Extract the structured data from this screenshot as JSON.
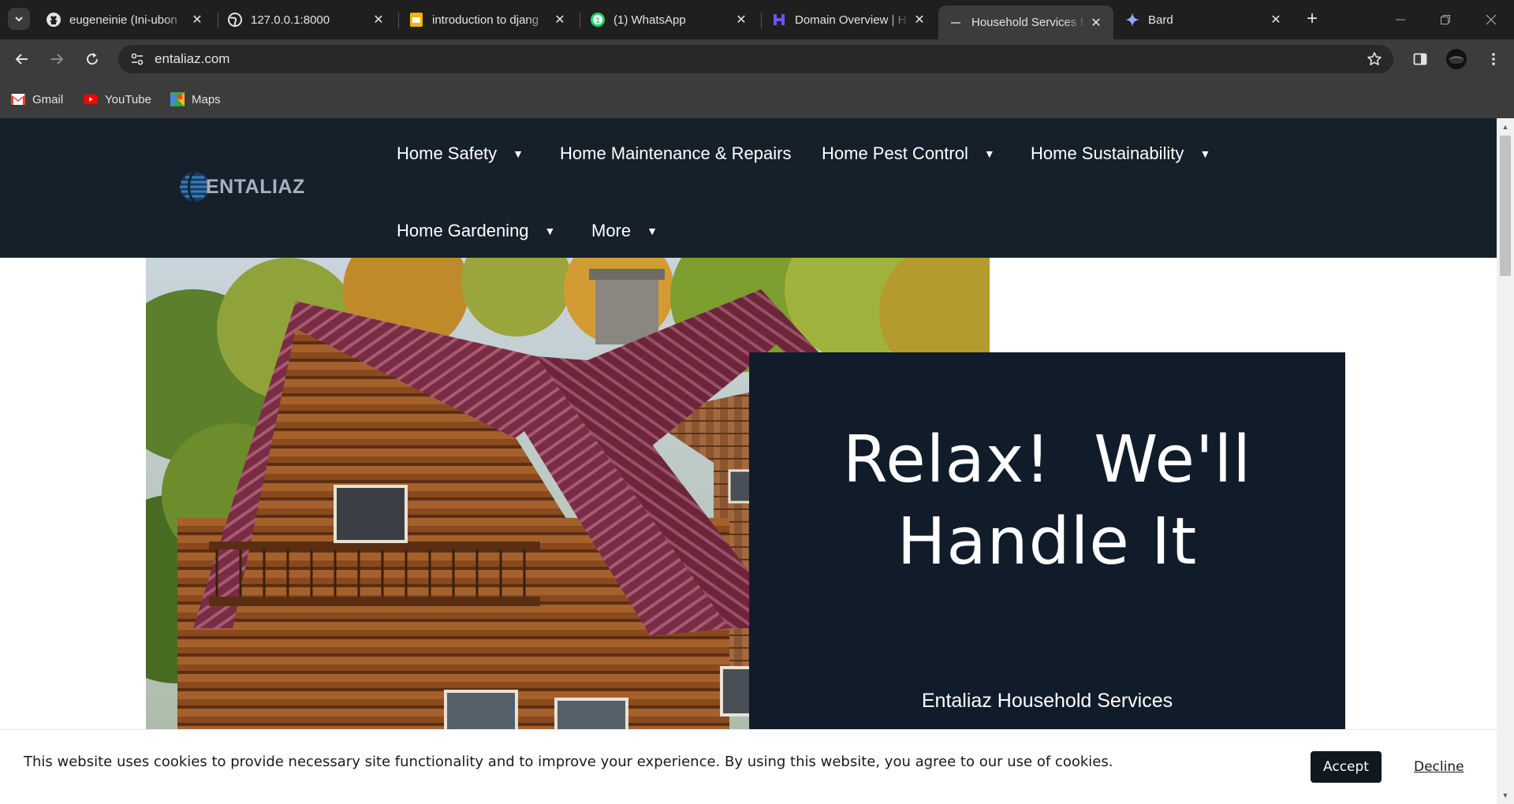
{
  "browser": {
    "tabs": [
      {
        "title": "eugeneinie (Ini-ubon",
        "icon": "github-icon"
      },
      {
        "title": "127.0.0.1:8000",
        "icon": "globe-icon"
      },
      {
        "title": "introduction to djang",
        "icon": "slides-icon"
      },
      {
        "title": "(1) WhatsApp",
        "icon": "whatsapp-icon"
      },
      {
        "title": "Domain Overview | H",
        "icon": "semrush-icon"
      },
      {
        "title": "Household Services f",
        "icon": "site-icon",
        "active": true
      },
      {
        "title": "Bard",
        "icon": "bard-icon"
      }
    ],
    "address": "entaliaz.com",
    "bookmarks": [
      {
        "label": "Gmail",
        "icon": "gmail-icon"
      },
      {
        "label": "YouTube",
        "icon": "youtube-icon"
      },
      {
        "label": "Maps",
        "icon": "maps-icon"
      }
    ]
  },
  "site": {
    "logo_text": "ENTALIAZ",
    "nav": [
      {
        "label": "Home Safety",
        "has_dropdown": true
      },
      {
        "label": "Home Maintenance & Repairs",
        "has_dropdown": false
      },
      {
        "label": "Home Pest Control",
        "has_dropdown": true
      },
      {
        "label": "Home Sustainability",
        "has_dropdown": true
      },
      {
        "label": "Home Gardening",
        "has_dropdown": true
      },
      {
        "label": "More",
        "has_dropdown": true
      }
    ],
    "hero": {
      "title_line1": "Relax!  We'll",
      "title_line2": "Handle It",
      "subtitle": "Entaliaz Household Services"
    },
    "cookie": {
      "text": "This website uses cookies to provide necessary site functionality and to improve your experience. By using this website, you agree to our use of cookies.",
      "accept": "Accept",
      "decline": "Decline"
    }
  },
  "colors": {
    "header_bg": "#15202b",
    "hero_card_bg": "#111c2b",
    "roof": "#7a2c44",
    "logs": "#8a4a1e"
  }
}
